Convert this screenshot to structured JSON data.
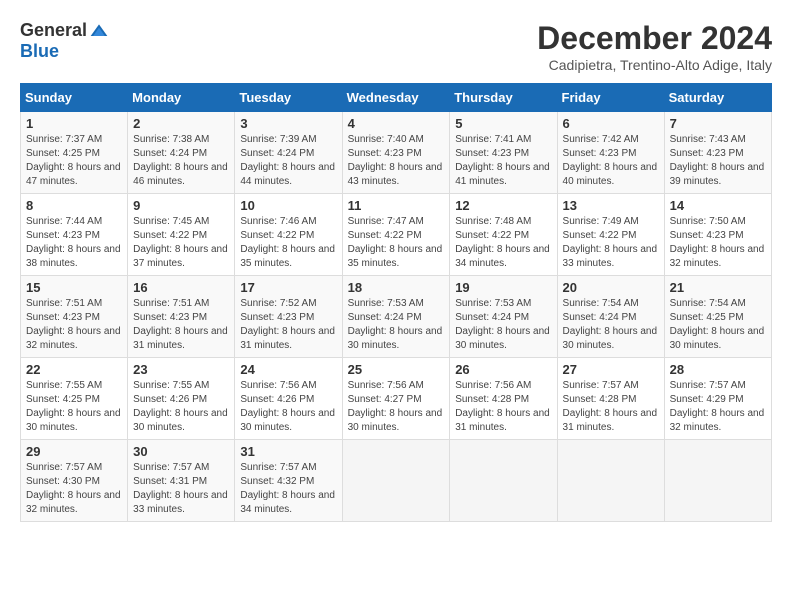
{
  "logo": {
    "general": "General",
    "blue": "Blue"
  },
  "title": "December 2024",
  "location": "Cadipietra, Trentino-Alto Adige, Italy",
  "days_of_week": [
    "Sunday",
    "Monday",
    "Tuesday",
    "Wednesday",
    "Thursday",
    "Friday",
    "Saturday"
  ],
  "weeks": [
    [
      {
        "day": "1",
        "sunrise": "7:37 AM",
        "sunset": "4:25 PM",
        "daylight": "8 hours and 47 minutes."
      },
      {
        "day": "2",
        "sunrise": "7:38 AM",
        "sunset": "4:24 PM",
        "daylight": "8 hours and 46 minutes."
      },
      {
        "day": "3",
        "sunrise": "7:39 AM",
        "sunset": "4:24 PM",
        "daylight": "8 hours and 44 minutes."
      },
      {
        "day": "4",
        "sunrise": "7:40 AM",
        "sunset": "4:23 PM",
        "daylight": "8 hours and 43 minutes."
      },
      {
        "day": "5",
        "sunrise": "7:41 AM",
        "sunset": "4:23 PM",
        "daylight": "8 hours and 41 minutes."
      },
      {
        "day": "6",
        "sunrise": "7:42 AM",
        "sunset": "4:23 PM",
        "daylight": "8 hours and 40 minutes."
      },
      {
        "day": "7",
        "sunrise": "7:43 AM",
        "sunset": "4:23 PM",
        "daylight": "8 hours and 39 minutes."
      }
    ],
    [
      {
        "day": "8",
        "sunrise": "7:44 AM",
        "sunset": "4:23 PM",
        "daylight": "8 hours and 38 minutes."
      },
      {
        "day": "9",
        "sunrise": "7:45 AM",
        "sunset": "4:22 PM",
        "daylight": "8 hours and 37 minutes."
      },
      {
        "day": "10",
        "sunrise": "7:46 AM",
        "sunset": "4:22 PM",
        "daylight": "8 hours and 35 minutes."
      },
      {
        "day": "11",
        "sunrise": "7:47 AM",
        "sunset": "4:22 PM",
        "daylight": "8 hours and 35 minutes."
      },
      {
        "day": "12",
        "sunrise": "7:48 AM",
        "sunset": "4:22 PM",
        "daylight": "8 hours and 34 minutes."
      },
      {
        "day": "13",
        "sunrise": "7:49 AM",
        "sunset": "4:22 PM",
        "daylight": "8 hours and 33 minutes."
      },
      {
        "day": "14",
        "sunrise": "7:50 AM",
        "sunset": "4:23 PM",
        "daylight": "8 hours and 32 minutes."
      }
    ],
    [
      {
        "day": "15",
        "sunrise": "7:51 AM",
        "sunset": "4:23 PM",
        "daylight": "8 hours and 32 minutes."
      },
      {
        "day": "16",
        "sunrise": "7:51 AM",
        "sunset": "4:23 PM",
        "daylight": "8 hours and 31 minutes."
      },
      {
        "day": "17",
        "sunrise": "7:52 AM",
        "sunset": "4:23 PM",
        "daylight": "8 hours and 31 minutes."
      },
      {
        "day": "18",
        "sunrise": "7:53 AM",
        "sunset": "4:24 PM",
        "daylight": "8 hours and 30 minutes."
      },
      {
        "day": "19",
        "sunrise": "7:53 AM",
        "sunset": "4:24 PM",
        "daylight": "8 hours and 30 minutes."
      },
      {
        "day": "20",
        "sunrise": "7:54 AM",
        "sunset": "4:24 PM",
        "daylight": "8 hours and 30 minutes."
      },
      {
        "day": "21",
        "sunrise": "7:54 AM",
        "sunset": "4:25 PM",
        "daylight": "8 hours and 30 minutes."
      }
    ],
    [
      {
        "day": "22",
        "sunrise": "7:55 AM",
        "sunset": "4:25 PM",
        "daylight": "8 hours and 30 minutes."
      },
      {
        "day": "23",
        "sunrise": "7:55 AM",
        "sunset": "4:26 PM",
        "daylight": "8 hours and 30 minutes."
      },
      {
        "day": "24",
        "sunrise": "7:56 AM",
        "sunset": "4:26 PM",
        "daylight": "8 hours and 30 minutes."
      },
      {
        "day": "25",
        "sunrise": "7:56 AM",
        "sunset": "4:27 PM",
        "daylight": "8 hours and 30 minutes."
      },
      {
        "day": "26",
        "sunrise": "7:56 AM",
        "sunset": "4:28 PM",
        "daylight": "8 hours and 31 minutes."
      },
      {
        "day": "27",
        "sunrise": "7:57 AM",
        "sunset": "4:28 PM",
        "daylight": "8 hours and 31 minutes."
      },
      {
        "day": "28",
        "sunrise": "7:57 AM",
        "sunset": "4:29 PM",
        "daylight": "8 hours and 32 minutes."
      }
    ],
    [
      {
        "day": "29",
        "sunrise": "7:57 AM",
        "sunset": "4:30 PM",
        "daylight": "8 hours and 32 minutes."
      },
      {
        "day": "30",
        "sunrise": "7:57 AM",
        "sunset": "4:31 PM",
        "daylight": "8 hours and 33 minutes."
      },
      {
        "day": "31",
        "sunrise": "7:57 AM",
        "sunset": "4:32 PM",
        "daylight": "8 hours and 34 minutes."
      },
      null,
      null,
      null,
      null
    ]
  ]
}
